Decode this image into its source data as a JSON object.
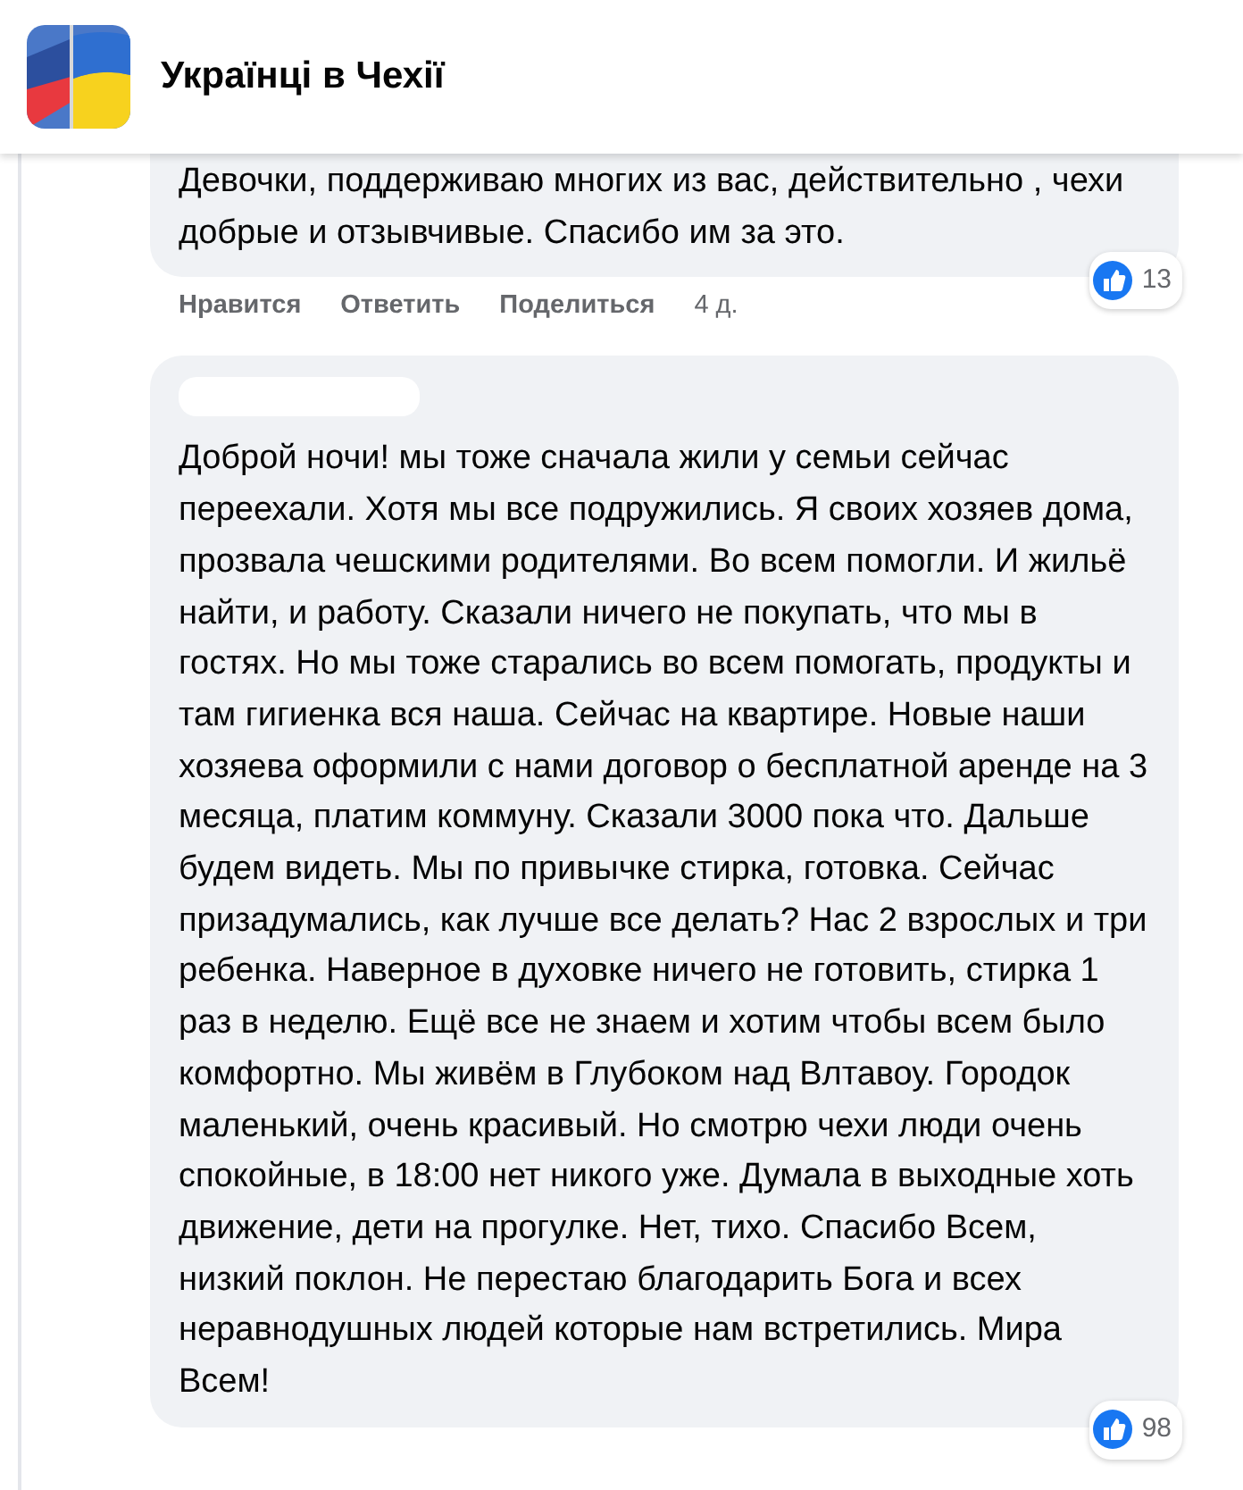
{
  "header": {
    "title": "Українці в Чехії"
  },
  "comments": [
    {
      "text": "Девочки, поддерживаю многих из вас, действительно , чехи добрые и отзывчивые. Спасибо им за это.",
      "actions": [
        "Нравится",
        "Ответить",
        "Поделиться"
      ],
      "time": "4 д.",
      "reactions": "13"
    },
    {
      "author_hidden": true,
      "text": "Доброй ночи! мы тоже сначала жили у семьи сейчас переехали. Хотя мы все подружились. Я своих хозяев дома, прозвала чешскими родителями. Во всем помогли. И жильё найти, и работу. Сказали ничего не покупать, что мы в гостях. Но мы тоже старались во всем помогать, продукты и там гигиенка вся наша. Сейчас на квартире. Новые наши хозяева оформили с нами договор о бесплатной аренде на 3 месяца, платим коммуну. Сказали 3000 пока что. Дальше будем видеть. Мы по привычке стирка, готовка. Сейчас призадумались, как лучше все делать? Нас 2 взрослых и три ребенка. Наверное в духовке ничего не готовить, стирка 1 раз в неделю. Ещё все не знаем и хотим чтобы всем было комфортно. Мы живём в Глубоком над Влтавоу. Городок маленький, очень красивый. Но смотрю чехи люди очень спокойные, в 18:00 нет никого уже. Думала в выходные хоть движение, дети на прогулке. Нет, тихо. Спасибо Всем, низкий поклон. Не перестаю благодарить Бога и всех неравнодушных людей которые нам встретились. Мира Всем!",
      "reactions": "98"
    }
  ]
}
